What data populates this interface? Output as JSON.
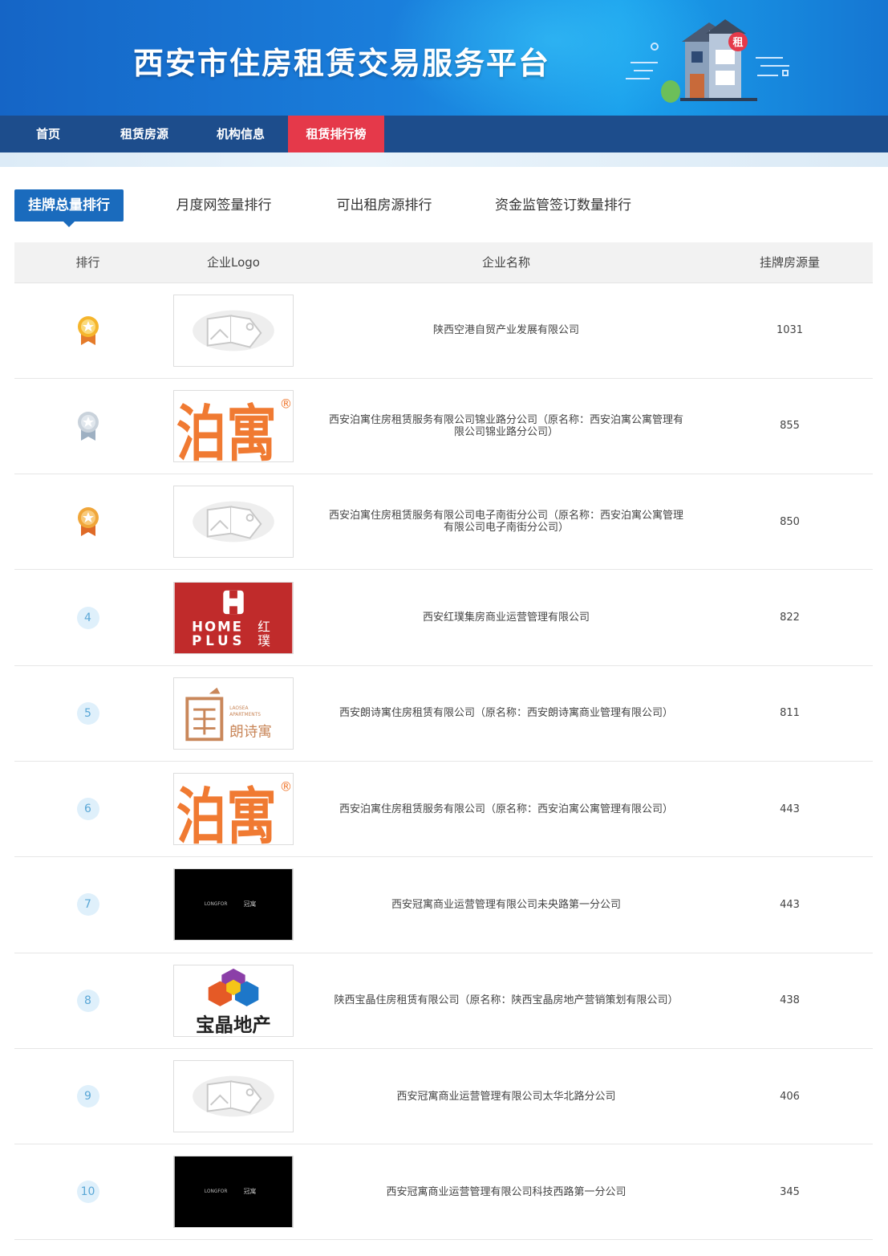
{
  "site": {
    "title": "西安市住房租赁交易服务平台",
    "banner_badge": "租"
  },
  "nav": {
    "items": [
      {
        "label": "首页",
        "active": false
      },
      {
        "label": "租赁房源",
        "active": false
      },
      {
        "label": "机构信息",
        "active": false
      },
      {
        "label": "租赁排行榜",
        "active": true
      }
    ]
  },
  "tabs": [
    {
      "label": "挂牌总量排行",
      "active": true
    },
    {
      "label": "月度网签量排行",
      "active": false
    },
    {
      "label": "可出租房源排行",
      "active": false
    },
    {
      "label": "资金监管签订数量排行",
      "active": false
    }
  ],
  "table": {
    "headers": {
      "rank": "排行",
      "logo": "企业Logo",
      "name": "企业名称",
      "count": "挂牌房源量"
    },
    "rows": [
      {
        "rank": "1",
        "rank_icon": "gold-medal-icon",
        "logo": "placeholder-image-icon",
        "name": "陕西空港自贸产业发展有限公司",
        "count": "1031"
      },
      {
        "rank": "2",
        "rank_icon": "silver-medal-icon",
        "logo": "bohe-logo",
        "name": "西安泊寓住房租赁服务有限公司锦业路分公司（原名称：西安泊寓公寓管理有限公司锦业路分公司）",
        "count": "855"
      },
      {
        "rank": "3",
        "rank_icon": "bronze-medal-icon",
        "logo": "placeholder-image-icon",
        "name": "西安泊寓住房租赁服务有限公司电子南街分公司（原名称：西安泊寓公寓管理有限公司电子南街分公司）",
        "count": "850"
      },
      {
        "rank": "4",
        "rank_icon": "",
        "logo": "homeplus-logo",
        "name": "西安红璞集房商业运营管理有限公司",
        "count": "822"
      },
      {
        "rank": "5",
        "rank_icon": "",
        "logo": "laosea-logo",
        "name": "西安朗诗寓住房租赁有限公司（原名称：西安朗诗寓商业管理有限公司）",
        "count": "811"
      },
      {
        "rank": "6",
        "rank_icon": "",
        "logo": "bohe-logo",
        "name": "西安泊寓住房租赁服务有限公司（原名称：西安泊寓公寓管理有限公司）",
        "count": "443"
      },
      {
        "rank": "7",
        "rank_icon": "",
        "logo": "longfor-logo",
        "name": "西安冠寓商业运营管理有限公司未央路第一分公司",
        "count": "443"
      },
      {
        "rank": "8",
        "rank_icon": "",
        "logo": "baojing-logo",
        "name": "陕西宝晶住房租赁有限公司（原名称：陕西宝晶房地产营销策划有限公司）",
        "count": "438"
      },
      {
        "rank": "9",
        "rank_icon": "",
        "logo": "placeholder-image-icon",
        "name": "西安冠寓商业运营管理有限公司太华北路分公司",
        "count": "406"
      },
      {
        "rank": "10",
        "rank_icon": "",
        "logo": "longfor-logo",
        "name": "西安冠寓商业运营管理有限公司科技西路第一分公司",
        "count": "345"
      }
    ]
  },
  "logos": {
    "bohe": {
      "text": "泊寓",
      "mark": "®"
    },
    "homeplus": {
      "line1": "HOME",
      "line2": "PLUS",
      "cn1": "红",
      "cn2": "璞"
    },
    "laosea": {
      "en1": "LAOSEA",
      "en2": "APARTMENTS",
      "cn": "朗诗寓"
    },
    "longfor": {
      "en": "LONGFOR",
      "cn": "冠寓"
    },
    "baojing": {
      "cn": "宝晶地产"
    }
  },
  "colors": {
    "nav_bg": "#1d4d8c",
    "nav_active": "#e5394a",
    "tab_active": "#1a6bbd",
    "bohe_orange": "#f07a32",
    "homeplus_red": "#c02b2b"
  }
}
